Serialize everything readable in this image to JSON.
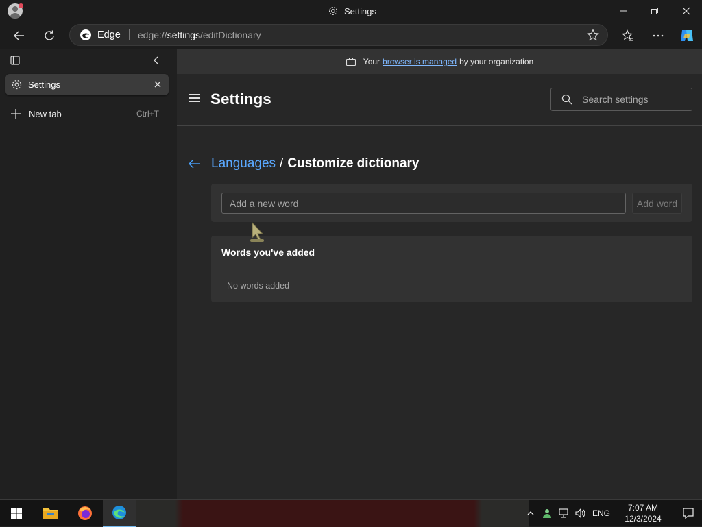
{
  "window": {
    "title": "Settings",
    "icon": "gear-icon",
    "controls": [
      "minimize-icon",
      "restore-icon",
      "close-icon"
    ]
  },
  "toolbar": {
    "back_icon": "back-arrow-icon",
    "refresh_icon": "refresh-icon",
    "address": {
      "brand": "Edge",
      "url_prefix": "edge://",
      "url_bold": "settings",
      "url_suffix": "/editDictionary"
    },
    "favorite_icon": "star-icon",
    "right_icons": [
      "favorites-icon",
      "more-icon",
      "copilot-icon"
    ]
  },
  "sidebar": {
    "tabs": [
      {
        "label": "Settings",
        "icon": "gear-icon",
        "active": true
      }
    ],
    "new_tab": {
      "label": "New tab",
      "shortcut": "Ctrl+T"
    }
  },
  "banner": {
    "before": "Your",
    "link": "browser is managed",
    "after": "by your organization",
    "icon": "briefcase-icon"
  },
  "header": {
    "title": "Settings",
    "search_placeholder": "Search settings"
  },
  "breadcrumb": {
    "parent": "Languages",
    "separator": "/",
    "current": "Customize dictionary"
  },
  "add_word": {
    "placeholder": "Add a new word",
    "value": "",
    "button": "Add word"
  },
  "words_section": {
    "heading": "Words you've added",
    "empty_text": "No words added"
  },
  "taskbar": {
    "apps": [
      "windows-start-icon",
      "file-explorer-icon",
      "firefox-icon",
      "edge-icon"
    ],
    "language": "ENG",
    "time": "7:07 AM",
    "date": "12/3/2024"
  },
  "colors": {
    "accent": "#4aa3ff",
    "surface": "#272727",
    "card": "#323232"
  }
}
